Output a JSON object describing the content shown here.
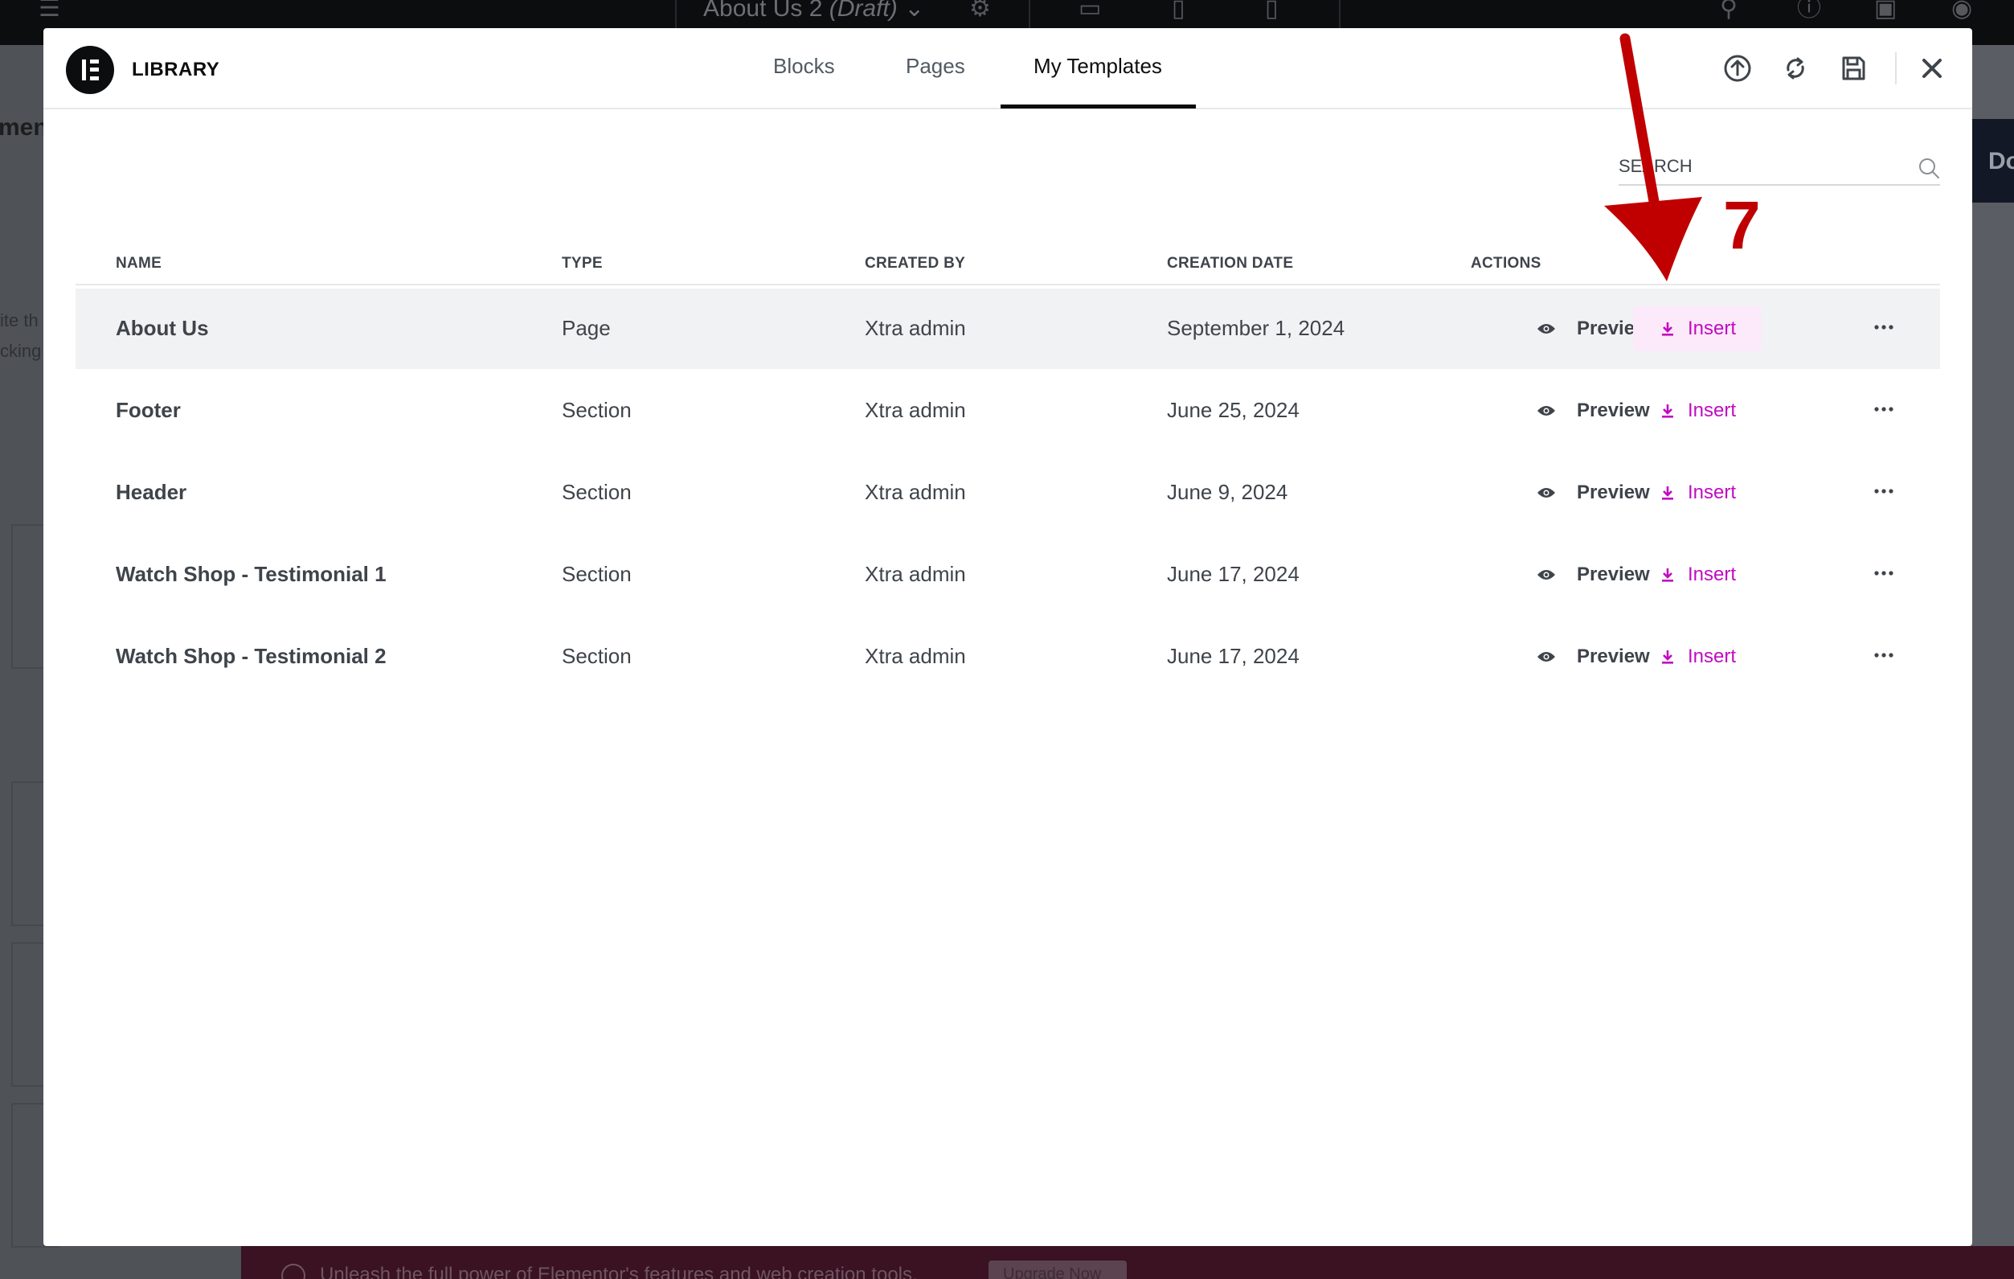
{
  "background": {
    "doc_title": "About Us 2",
    "doc_status": "(Draft)",
    "panel_word": "ments",
    "ghost_line1": "ite th",
    "ghost_line2": "cking",
    "right_partial": "Do",
    "promo_text": "Unleash the full power of Elementor's features and web creation tools.",
    "promo_button": "Upgrade Now"
  },
  "modal": {
    "title": "LIBRARY",
    "tabs": [
      {
        "label": "Blocks",
        "active": false
      },
      {
        "label": "Pages",
        "active": false
      },
      {
        "label": "My Templates",
        "active": true
      }
    ],
    "header_icons": [
      "upload-icon",
      "sync-icon",
      "save-icon",
      "close-icon"
    ],
    "search": {
      "placeholder": "SEARCH",
      "value": ""
    },
    "columns": [
      "NAME",
      "TYPE",
      "CREATED BY",
      "CREATION DATE",
      "ACTIONS"
    ],
    "rows": [
      {
        "name": "About Us",
        "type": "Page",
        "created_by": "Xtra admin",
        "date": "September 1, 2024",
        "preview": "Preview",
        "insert": "Insert"
      },
      {
        "name": "Footer",
        "type": "Section",
        "created_by": "Xtra admin",
        "date": "June 25, 2024",
        "preview": "Preview",
        "insert": "Insert"
      },
      {
        "name": "Header",
        "type": "Section",
        "created_by": "Xtra admin",
        "date": "June 9, 2024",
        "preview": "Preview",
        "insert": "Insert"
      },
      {
        "name": "Watch Shop - Testimonial 1",
        "type": "Section",
        "created_by": "Xtra admin",
        "date": "June 17, 2024",
        "preview": "Preview",
        "insert": "Insert"
      },
      {
        "name": "Watch Shop - Testimonial 2",
        "type": "Section",
        "created_by": "Xtra admin",
        "date": "June 17, 2024",
        "preview": "Preview",
        "insert": "Insert"
      }
    ],
    "colors": {
      "accent": "#c10bc1",
      "accent_bg": "#fce9f9",
      "text": "#3f444b",
      "highlight_row": "#f1f2f3"
    }
  },
  "annotation": {
    "step": "7",
    "color": "#c00000"
  }
}
